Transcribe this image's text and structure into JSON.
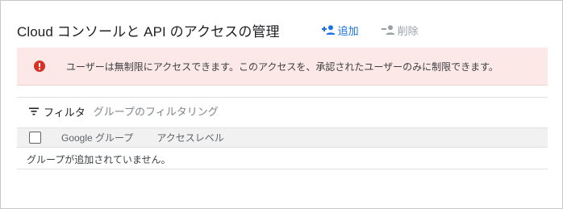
{
  "header": {
    "title": "Cloud コンソールと API のアクセスの管理",
    "add_label": "追加",
    "delete_label": "削除"
  },
  "banner": {
    "message": "ユーザーは無制限にアクセスできます。このアクセスを、承認されたユーザーのみに制限できます。",
    "icon": "error-icon"
  },
  "filter": {
    "label": "フィルタ",
    "placeholder": "グループのフィルタリング",
    "icon": "filter-icon"
  },
  "table": {
    "columns": [
      "Google グループ",
      "アクセスレベル"
    ],
    "empty_message": "グループが追加されていません。"
  },
  "colors": {
    "accent": "#1a73e8",
    "error": "#d93025",
    "banner_bg": "#fce8e6",
    "disabled": "#9aa0a6"
  }
}
